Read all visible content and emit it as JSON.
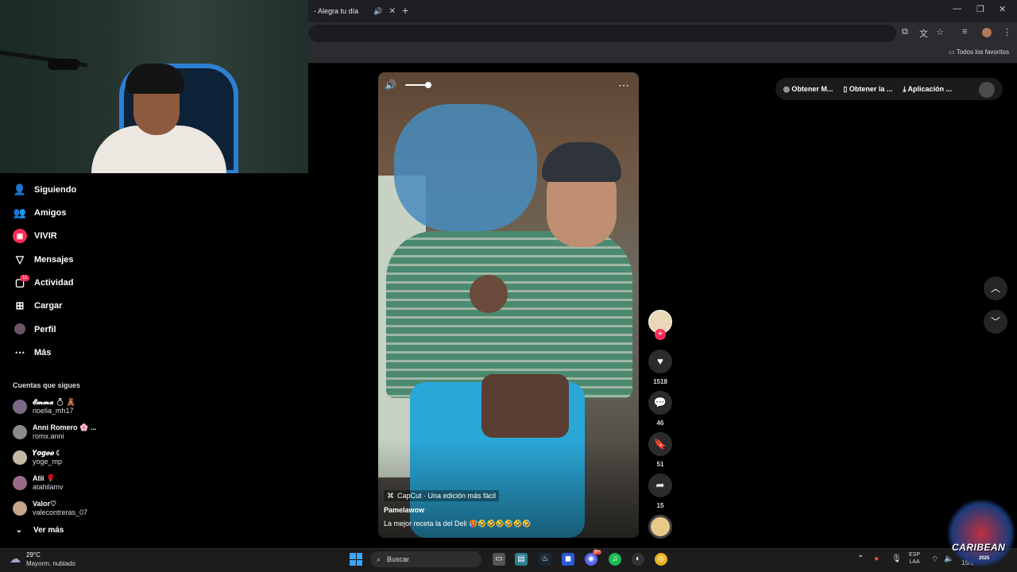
{
  "browser": {
    "tab_title": "- Alegra tu día",
    "new_tab": "+",
    "bookmarks_label": "Todos los favoritos"
  },
  "sidebar": {
    "items": [
      {
        "label": "Siguiendo",
        "icon": "following-icon"
      },
      {
        "label": "Amigos",
        "icon": "friends-icon"
      },
      {
        "label": "VIVIR",
        "icon": "live-icon"
      },
      {
        "label": "Mensajes",
        "icon": "messages-icon"
      },
      {
        "label": "Actividad",
        "icon": "activity-icon"
      },
      {
        "label": "Cargar",
        "icon": "upload-icon"
      },
      {
        "label": "Perfil",
        "icon": "profile-icon"
      },
      {
        "label": "Más",
        "icon": "more-icon"
      }
    ],
    "activity_badge": "11",
    "following_title": "Cuentas que sigues",
    "accounts": [
      {
        "name": "𝓔𝓶𝓶𝓪 💍 🧸",
        "username": "noelia_mh17",
        "color": "#7a6a88"
      },
      {
        "name": "Anni Romero 🌸 ...",
        "username": "romx.anni",
        "color": "#8a8a8a"
      },
      {
        "name": "𝒀𝒐𝒈𝒆𝒆 ☾",
        "username": "yoge_mp",
        "color": "#c8b8a6"
      },
      {
        "name": "Atii 🌹",
        "username": "atahilamv",
        "color": "#9a6a88"
      },
      {
        "name": "Valor♡",
        "username": "valecontreras_07",
        "color": "#c7a58a"
      }
    ],
    "see_more": "Ver más"
  },
  "video": {
    "capcut_label": "CapCut · Una edición más fácil",
    "author": "Pamelawow",
    "caption": "La mejor receta la del Deli 🥵🤣🤣🤣🤣🤣🤣"
  },
  "actions": {
    "likes": "1518",
    "comments": "46",
    "saves": "51",
    "shares": "15",
    "follow_plus": "+"
  },
  "topbar": {
    "get_coins": "Obtener M...",
    "get_app": "Obtener la ...",
    "desktop_app": "Aplicación ..."
  },
  "taskbar": {
    "temperature": "29°C",
    "condition": "Mayorm. nublado",
    "search_placeholder": "Buscar",
    "lang_1": "ESP",
    "lang_2": "LAA",
    "clock": "15/2",
    "discord_badge": "9+"
  },
  "overlay": {
    "logo_text": "CARIBEAN",
    "logo_year": "2025"
  },
  "colors": {
    "accent": "#fe2c55",
    "windows_blue": "#3aa6ff"
  }
}
